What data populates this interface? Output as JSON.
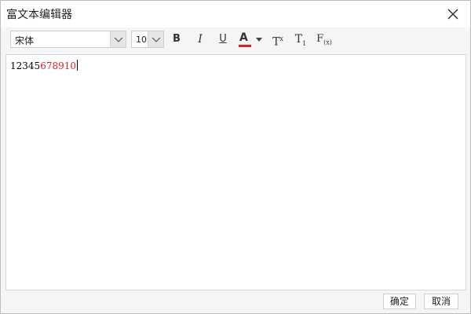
{
  "dialog": {
    "title": "富文本编辑器"
  },
  "toolbar": {
    "font_family_value": "宋体",
    "font_size_value": "10",
    "bold_label": "B",
    "italic_label": "I",
    "underline_label": "U",
    "font_color_label": "A",
    "font_color_swatch": "#e01e1e",
    "superscript_label": "T",
    "superscript_mark": "x",
    "subscript_label": "T",
    "subscript_mark": "1",
    "formula_label": "F",
    "formula_mark": "(x)",
    "icons": [
      "close-icon",
      "chevron-down-icon",
      "caret-down-icon"
    ]
  },
  "editor": {
    "text_black": "12345",
    "text_red": "678910",
    "red_color": "#e01e1e"
  },
  "footer": {
    "ok_label": "确定",
    "cancel_label": "取消"
  }
}
